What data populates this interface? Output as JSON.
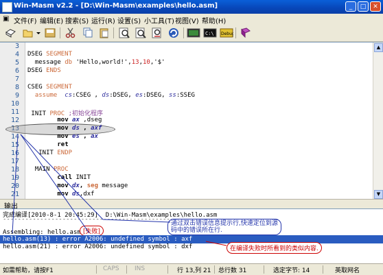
{
  "window": {
    "title": "Win-Masm v2.2 - [D:\\Win-Masm\\examples\\hello.asm]"
  },
  "menu": [
    "文件(F)",
    "编辑(E)",
    "搜索(S)",
    "运行(R)",
    "设置(S)",
    "小工具(T)",
    "视图(V)",
    "帮助(H)"
  ],
  "editor": {
    "line_numbers": [
      "3",
      "4",
      "5",
      "6",
      "7",
      "8",
      "9",
      "10",
      "11",
      "12",
      "13",
      "14",
      "15",
      "16",
      "17",
      "18",
      "19",
      "20",
      "21"
    ],
    "code": {
      "l4": [
        "DSEG ",
        "SEGMENT"
      ],
      "l5": [
        "  message ",
        "db",
        " 'Hello,world!',",
        "13",
        ",",
        "10",
        ",'$'"
      ],
      "l6": [
        "DSEG ",
        "ENDS"
      ],
      "l8": [
        "CSEG ",
        "SEGMENT"
      ],
      "l9": [
        "  ",
        "assume",
        "  ",
        "cs",
        ":CSEG , ",
        "ds",
        ":DSEG, ",
        "es",
        ":DSEG, ",
        "ss",
        ":SSEG"
      ],
      "l11": [
        " INIT ",
        "PROC",
        " ;初始化程序"
      ],
      "l12": [
        "        ",
        "mov",
        " ",
        "ax",
        " ,dseg"
      ],
      "l13": [
        "        ",
        "mov",
        " ",
        "ds",
        " , ",
        "axf"
      ],
      "l14": [
        "        ",
        "mov",
        " ",
        "es",
        " , ",
        "ax"
      ],
      "l15": [
        "        ",
        "ret"
      ],
      "l16": [
        "   INIT ",
        "ENDP"
      ],
      "l18": [
        "  MAIN ",
        "PROC"
      ],
      "l19": [
        "        ",
        "call",
        " INIT"
      ],
      "l20": [
        "        ",
        "mov",
        " ",
        "dx",
        ", ",
        "seg",
        " message"
      ],
      "l21": [
        "        ",
        "mov",
        " ",
        "ds",
        ",dxf"
      ]
    }
  },
  "output": {
    "title": "输出",
    "header": "完成编译[2010-8-1 20:45:29]  D:\\Win-Masm\\examples\\hello.asm",
    "divider": "------------------------------------------------------------------------",
    "assembling": "Assembling: hello.asm",
    "fail_badge": "[失败]",
    "error1": "hello.asm(13) : error A2006: undefined symbol : axf",
    "error2": "hello.asm(21) : error A2006: undefined symbol : dxf"
  },
  "annotations": {
    "double_click": "通过双击错误信息提示行,快速定位到源\n码中的错误所在行.",
    "fail_info": "在编译失败时所看到的类似内容."
  },
  "status": {
    "help": "如需帮助，请按F1",
    "caps": "CAPS",
    "ins": "INS",
    "position": "行 13,列 21",
    "total_lines": "总行数 31",
    "selected": "选定字节: 14",
    "mode": "英取网名"
  },
  "icons": [
    "new-icon",
    "open-icon",
    "dropdown-arrow-icon",
    "save-icon",
    "cut-icon",
    "copy-icon",
    "paste-icon",
    "find-icon",
    "find-next-icon",
    "replace-icon",
    "refresh-icon",
    "build-icon",
    "run-icon",
    "debug-icon",
    "help-book-icon"
  ]
}
